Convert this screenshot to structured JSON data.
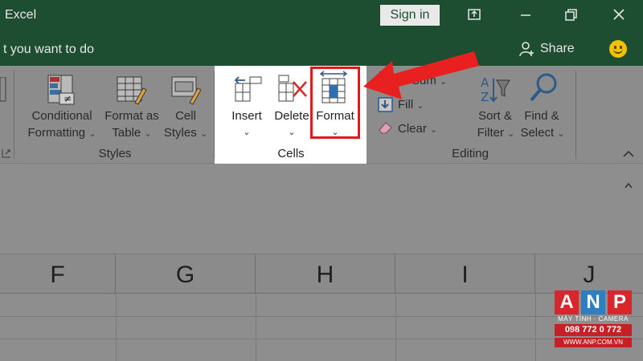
{
  "titlebar": {
    "app_title": "Excel",
    "signin_label": "Sign in"
  },
  "tellbar": {
    "tell_me": "t you want to do",
    "share_label": "Share"
  },
  "ribbon": {
    "styles": {
      "conditional_line1": "Conditional",
      "conditional_line2": "Formatting",
      "format_table_line1": "Format as",
      "format_table_line2": "Table",
      "cell_styles_line1": "Cell",
      "cell_styles_line2": "Styles",
      "group_label": "Styles"
    },
    "cells": {
      "insert_label": "Insert",
      "delete_label": "Delete",
      "format_label": "Format",
      "group_label": "Cells"
    },
    "editing": {
      "autosum_label": "Sum",
      "fill_label": "Fill",
      "clear_label": "Clear",
      "sort_line1": "Sort &",
      "sort_line2": "Filter",
      "find_line1": "Find &",
      "find_line2": "Select",
      "group_label": "Editing"
    }
  },
  "columns": [
    "F",
    "G",
    "H",
    "I",
    "J"
  ],
  "watermark": {
    "letters": [
      "A",
      "N",
      "P"
    ],
    "letter_colors": [
      "#d9262c",
      "#2e7fc0",
      "#d9262c"
    ],
    "subtitle": "MÁY TÍNH · CAMERA",
    "phone": "098 772 0 772",
    "site": "WWW.ANP.COM.VN"
  },
  "colors": {
    "titlebar": "#1e4e32",
    "highlight": "#e01a1a"
  }
}
